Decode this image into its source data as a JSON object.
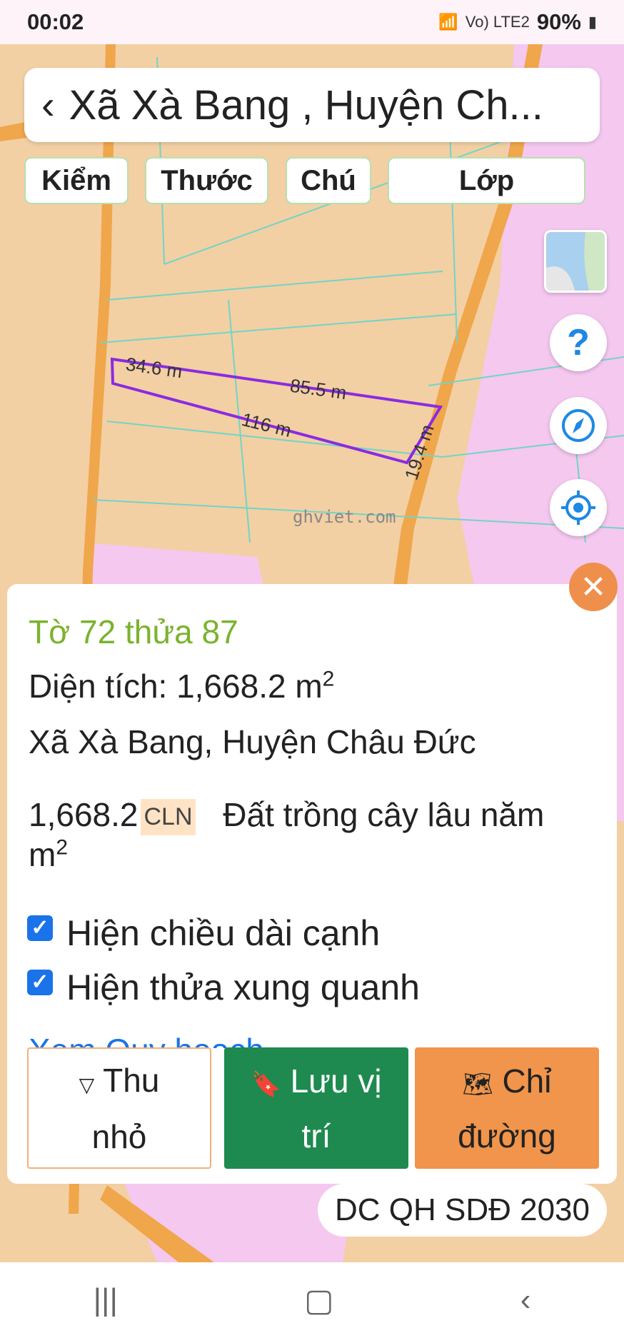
{
  "status": {
    "time": "00:02",
    "battery": "90%",
    "signal_label": "Vo) LTE2"
  },
  "header": {
    "back_icon": "chevron-left-icon",
    "title": "Xã Xà Bang , Huyện Ch..."
  },
  "toolbar": {
    "kiem": "Kiểm",
    "thuoc": "Thước",
    "chu": "Chú",
    "lop": "Lớp"
  },
  "map_labels": {
    "edge1": "34.6 m",
    "edge2": "85.5 m",
    "edge3": "116 m",
    "edge4": "19.4 m",
    "watermark": "ghviet.com"
  },
  "fabs": {
    "help": "?"
  },
  "info": {
    "parcel": "Tờ 72 thửa 87",
    "area_label": "Diện tích: 1,668.2 m",
    "area_sup": "2",
    "address": "Xã Xà Bang, Huyện Châu Đức",
    "land_area": "1,668.2",
    "land_unit": "m",
    "land_unit_sup": "2",
    "land_code": "CLN",
    "land_type": "Đất trồng cây lâu năm",
    "chk1": "Hiện chiều dài cạnh",
    "chk2": "Hiện thửa xung quanh",
    "hidden_link": "Xem Quy hoạch"
  },
  "buttons": {
    "collapse_line1": "Thu",
    "collapse_line2": "nhỏ",
    "save_line1": "Lưu vị",
    "save_line2": "trí",
    "direction_line1": "Chỉ",
    "direction_line2": "đường"
  },
  "layer_badge": "DC QH SDĐ 2030",
  "colors": {
    "accent_green": "#1e8a4f",
    "accent_orange": "#f0954b",
    "parcel_line": "#8a2be2"
  }
}
